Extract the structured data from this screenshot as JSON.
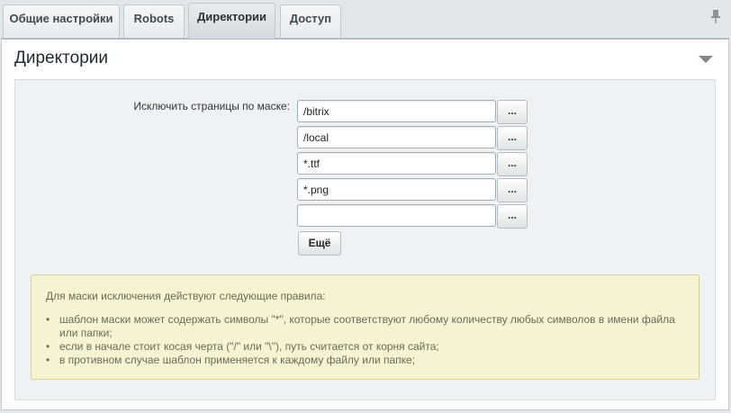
{
  "tabs": [
    {
      "label": "Общие настройки",
      "active": false
    },
    {
      "label": "Robots",
      "active": false
    },
    {
      "label": "Директории",
      "active": true
    },
    {
      "label": "Доступ",
      "active": false
    }
  ],
  "pin_icon": "pin-icon",
  "panel": {
    "title": "Директории",
    "collapse_icon": "chevron-down-icon"
  },
  "form": {
    "exclude_label": "Исключить страницы по маске:",
    "masks": [
      "/bitrix",
      "/local",
      "*.ttf",
      "*.png",
      ""
    ],
    "browse_label": "...",
    "more_label": "Ещё"
  },
  "note": {
    "heading": "Для маски исключения действуют следующие правила:",
    "rules": [
      "шаблон маски может содержать символы \"*\", которые соответствуют любому количеству любых символов в имени файла или папки;",
      "если в начале стоит косая черта (\"/\" или \"\\\"), путь считается от корня сайта;",
      "в противном случае шаблон применяется к каждому файлу или папке;"
    ]
  },
  "colors": {
    "note_background": "#f6f3d3",
    "note_border": "#d8cf99",
    "content_background": "#eef2f4"
  }
}
